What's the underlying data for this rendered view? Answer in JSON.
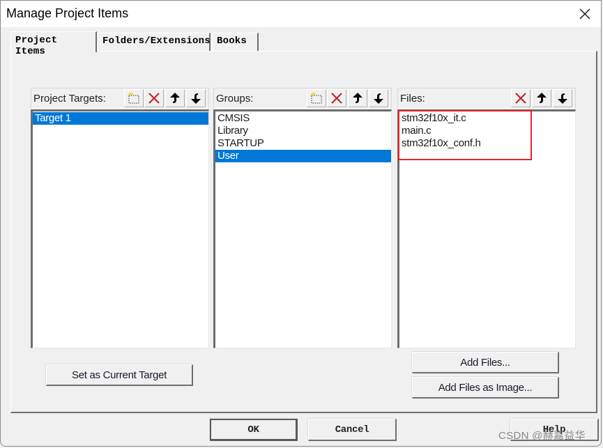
{
  "window": {
    "title": "Manage Project Items",
    "close_icon": "close-icon"
  },
  "tabs": [
    {
      "label": "Project Items",
      "active": true
    },
    {
      "label": "Folders/Extensions",
      "active": false
    },
    {
      "label": "Books",
      "active": false
    }
  ],
  "columns": {
    "targets": {
      "label": "Project Targets:",
      "toolbar": [
        "new-icon",
        "delete-icon",
        "move-up-icon",
        "move-down-icon"
      ],
      "items": [
        {
          "label": "Target 1",
          "selected": true
        }
      ]
    },
    "groups": {
      "label": "Groups:",
      "toolbar": [
        "new-icon",
        "delete-icon",
        "move-up-icon",
        "move-down-icon"
      ],
      "items": [
        {
          "label": "CMSIS",
          "selected": false
        },
        {
          "label": "Library",
          "selected": false
        },
        {
          "label": "STARTUP",
          "selected": false
        },
        {
          "label": "User",
          "selected": true
        }
      ]
    },
    "files": {
      "label": "Files:",
      "toolbar": [
        "delete-icon",
        "move-up-icon",
        "move-down-icon"
      ],
      "items": [
        {
          "label": "stm32f10x_it.c",
          "selected": false
        },
        {
          "label": "main.c",
          "selected": false
        },
        {
          "label": "stm32f10x_conf.h",
          "selected": false
        }
      ]
    }
  },
  "buttons": {
    "set_current_target": "Set as Current Target",
    "add_files": "Add Files...",
    "add_files_as_image": "Add Files as Image...",
    "ok": "OK",
    "cancel": "Cancel",
    "help": "Help"
  },
  "annotation": {
    "highlight_color": "#e8242c"
  },
  "colors": {
    "selection": "#0078d7",
    "delete_icon": "#c0282b"
  },
  "watermark": "CSDN @赫嘉益华"
}
